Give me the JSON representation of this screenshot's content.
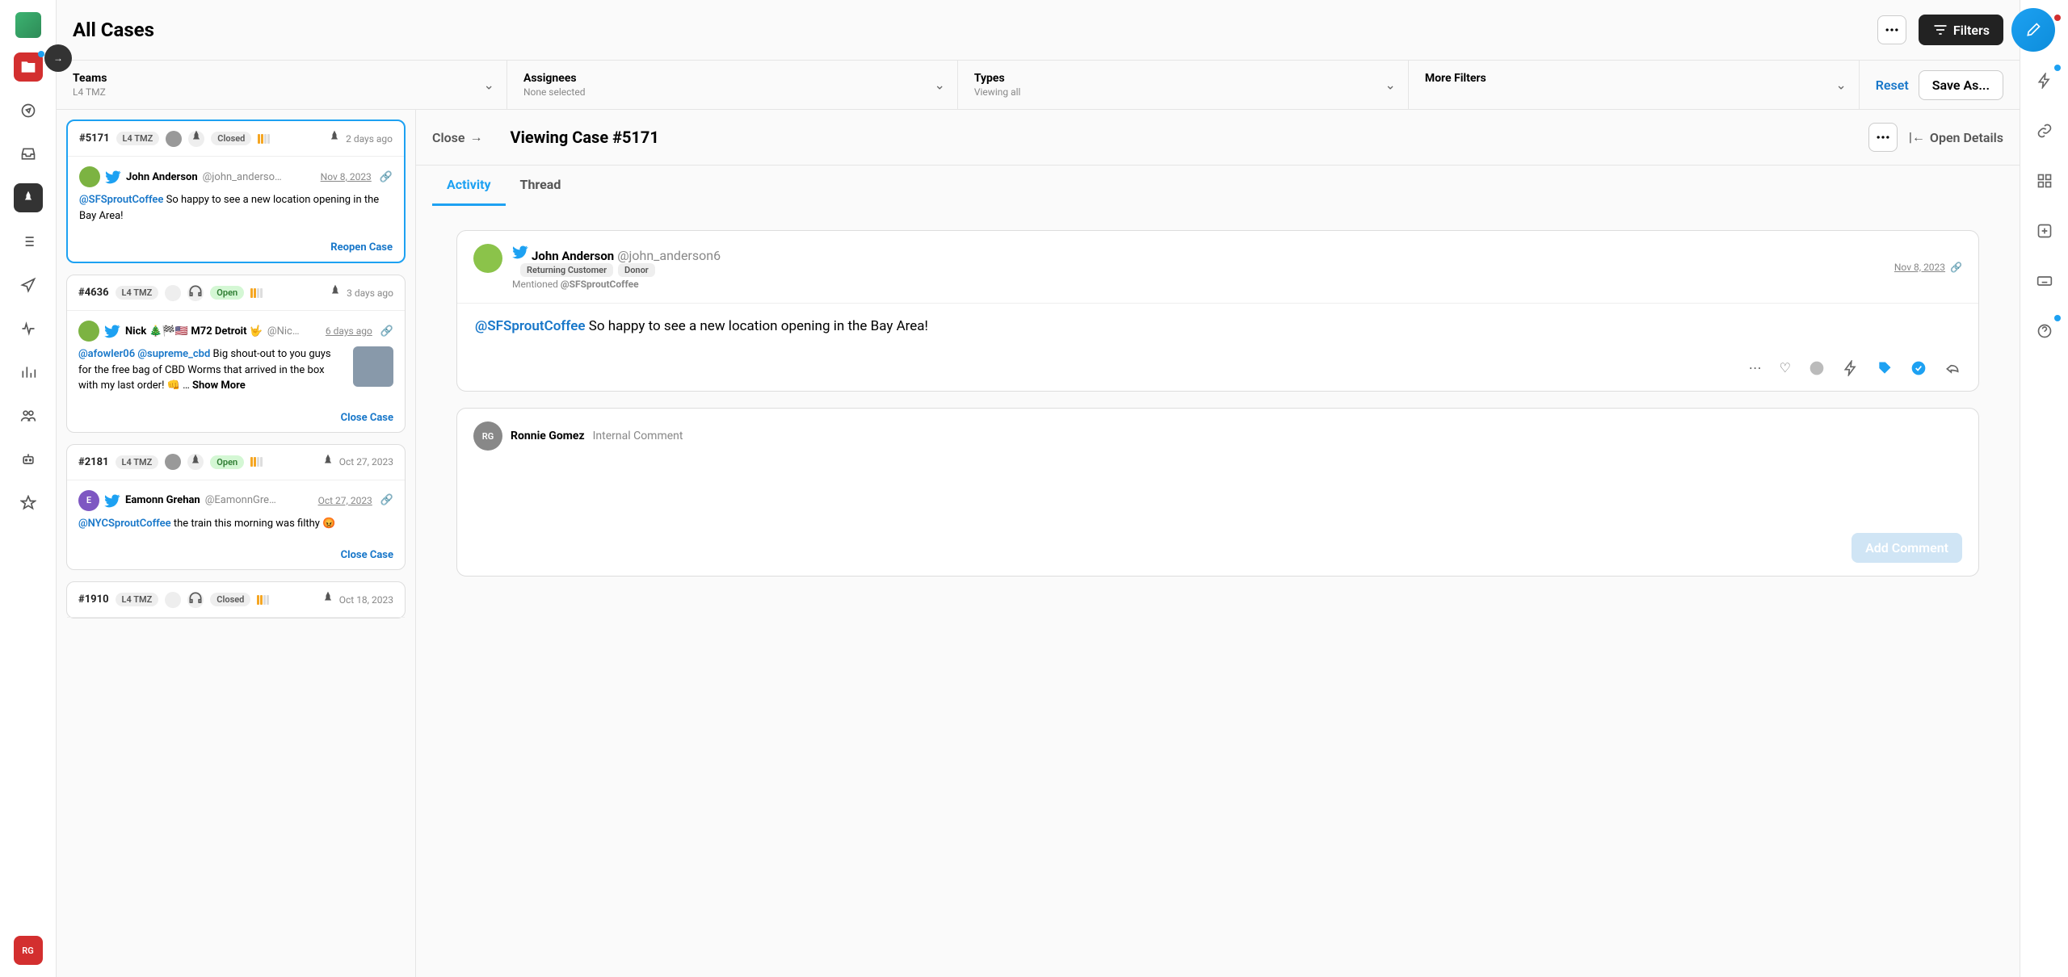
{
  "header": {
    "title": "All Cases",
    "filters_btn": "Filters",
    "reset": "Reset",
    "save_as": "Save As..."
  },
  "filters": [
    {
      "label": "Teams",
      "sub": "L4 TMZ"
    },
    {
      "label": "Assignees",
      "sub": "None selected"
    },
    {
      "label": "Types",
      "sub": "Viewing all"
    },
    {
      "label": "More Filters",
      "sub": ""
    }
  ],
  "cases": [
    {
      "id": "#5171",
      "team": "L4 TMZ",
      "status": "Closed",
      "status_open": false,
      "time": "2 days ago",
      "author": "John Anderson",
      "handle": "@john_anderso…",
      "date": "Nov 8, 2023",
      "mention": "@SFSproutCoffee",
      "text": " So happy to see a new location opening in the Bay Area!",
      "action": "Reopen Case",
      "selected": true,
      "has_avatar": true,
      "has_pin": true
    },
    {
      "id": "#4636",
      "team": "L4 TMZ",
      "status": "Open",
      "status_open": true,
      "time": "3 days ago",
      "author": "Nick 🎄🏁🇺🇸 M72 Detroit 🤟",
      "handle": "@Nic…",
      "date": "6 days ago",
      "mention": "@afowler06",
      "mention2": "@supreme_cbd",
      "text": " Big shout-out to you guys for the free bag of CBD Worms that arrived in the box with my last order! 👊 …  ",
      "show_more": "Show More",
      "action": "Close Case",
      "has_headset": true,
      "has_thumb": true
    },
    {
      "id": "#2181",
      "team": "L4 TMZ",
      "status": "Open",
      "status_open": true,
      "time": "Oct 27, 2023",
      "author": "Eamonn Grehan",
      "handle": "@EamonnGre…",
      "date": "Oct 27, 2023",
      "mention": "@NYCSproutCoffee",
      "text": " the train this morning was filthy 😡",
      "action": "Close Case",
      "has_avatar": true,
      "has_pin": true,
      "avatar_letter": "E"
    },
    {
      "id": "#1910",
      "team": "L4 TMZ",
      "status": "Closed",
      "status_open": false,
      "time": "Oct 18, 2023",
      "has_headset": true
    }
  ],
  "detail": {
    "close": "Close",
    "title": "Viewing Case #5171",
    "open_details": "Open Details",
    "tabs": [
      "Activity",
      "Thread"
    ],
    "post": {
      "author": "John Anderson",
      "handle": "@john_anderson6",
      "badges": [
        "Returning Customer",
        "Donor"
      ],
      "date": "Nov 8, 2023",
      "sub_prefix": "Mentioned ",
      "sub_mention": "@SFSproutCoffee",
      "mention": "@SFSproutCoffee",
      "text": " So happy to see a new location opening in the Bay Area!"
    },
    "comment": {
      "author": "Ronnie Gomez",
      "label": "Internal Comment",
      "button": "Add Comment",
      "initials": "RG"
    }
  },
  "user_initials": "RG"
}
